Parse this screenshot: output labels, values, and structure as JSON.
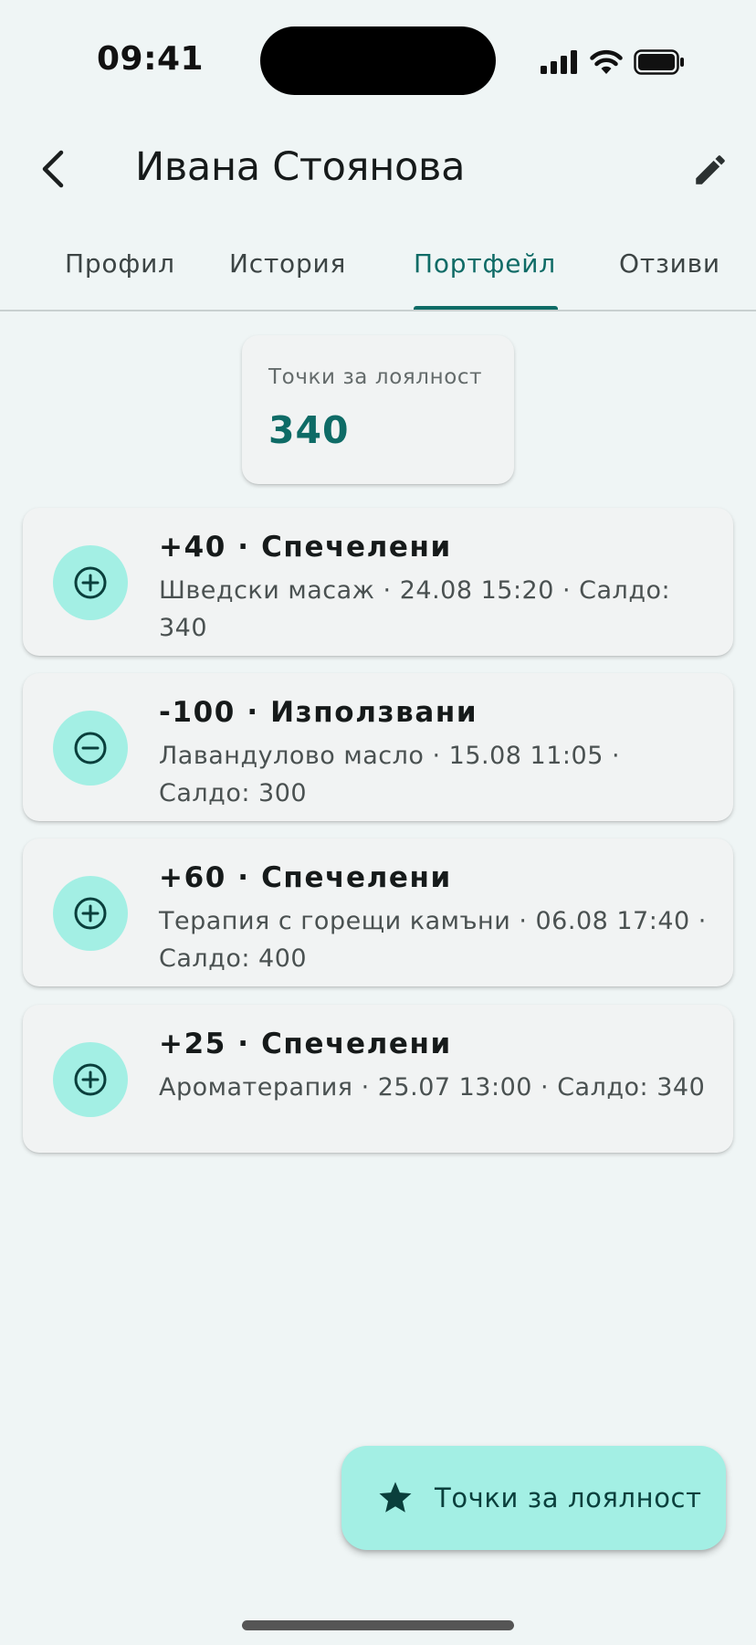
{
  "status_bar": {
    "time": "09:41"
  },
  "header": {
    "title": "Ивана Стоянова"
  },
  "tabs": [
    {
      "label": "Профил",
      "active": false
    },
    {
      "label": "История",
      "active": false
    },
    {
      "label": "Портфейл",
      "active": true
    },
    {
      "label": "Отзиви",
      "active": false
    }
  ],
  "points": {
    "label": "Точки за лоялност",
    "value": "340"
  },
  "transactions": [
    {
      "icon": "plus-circle-icon",
      "title": "+40 · Спечелени",
      "subtitle": "Шведски масаж · 24.08 15:20 · Салдо: 340"
    },
    {
      "icon": "minus-circle-icon",
      "title": "-100 · Използвани",
      "subtitle": "Лавандулово масло · 15.08 11:05 · Салдо: 300"
    },
    {
      "icon": "plus-circle-icon",
      "title": "+60 · Спечелени",
      "subtitle": "Терапия с горещи камъни · 06.08 17:40 · Салдо: 400"
    },
    {
      "icon": "plus-circle-icon",
      "title": "+25 · Спечелени",
      "subtitle": "Ароматерапия · 25.07 13:00 · Салдо: 340"
    }
  ],
  "fab": {
    "label": "Точки за лоялност",
    "icon": "star-icon"
  },
  "colors": {
    "accent": "#0e6b66",
    "avatar_bg": "#a3efe4",
    "background": "#eff5f5",
    "card": "#f1f3f3"
  }
}
